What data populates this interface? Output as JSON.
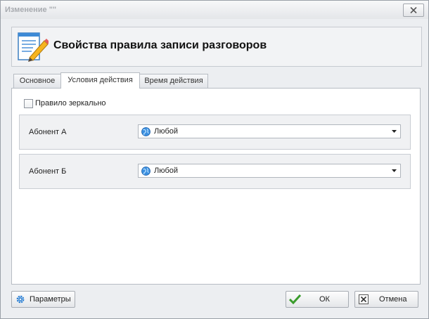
{
  "window": {
    "title": "Изменение \"\""
  },
  "header": {
    "title": "Свойства правила записи разговоров"
  },
  "tabs": [
    {
      "label": "Основное",
      "active": false
    },
    {
      "label": "Условия действия",
      "active": true
    },
    {
      "label": "Время действия",
      "active": false
    }
  ],
  "mirror_checkbox": {
    "label": "Правило зеркально",
    "checked": false
  },
  "subscriber_a": {
    "label": "Абонент А",
    "value": "Любой"
  },
  "subscriber_b": {
    "label": "Абонент Б",
    "value": "Любой"
  },
  "buttons": {
    "params": "Параметры",
    "ok": "ОК",
    "cancel": "Отмена"
  },
  "icons": {
    "close": "close-icon",
    "header": "document-edit-icon",
    "combo": "globe-icon",
    "params": "gear-icon",
    "ok": "checkmark-icon",
    "cancel": "cancel-icon"
  },
  "colors": {
    "accent_blue": "#2a7fd4",
    "ok_green": "#3a9c2c"
  }
}
